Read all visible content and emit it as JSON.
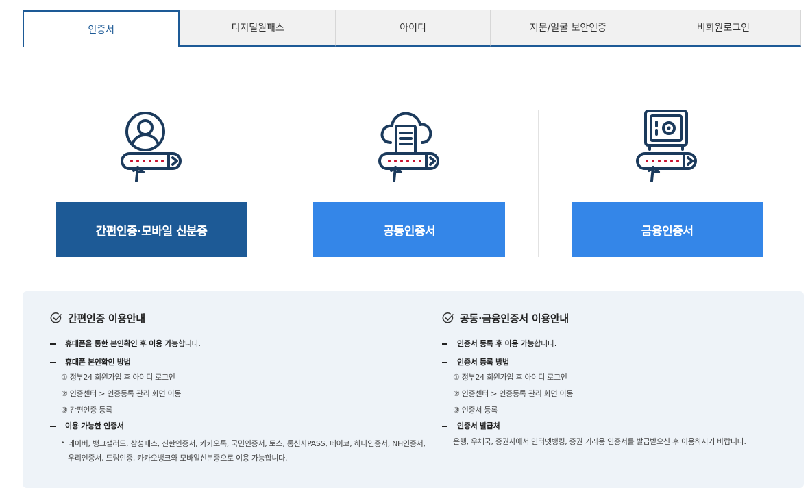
{
  "tabs": [
    {
      "label": "인증서",
      "active": true
    },
    {
      "label": "디지털원패스",
      "active": false
    },
    {
      "label": "아이디",
      "active": false
    },
    {
      "label": "지문/얼굴 보안인증",
      "active": false
    },
    {
      "label": "비회원로그인",
      "active": false
    }
  ],
  "options": [
    {
      "icon": "user-certificate-icon",
      "label": "간편인증·모바일 신분증",
      "color": "#1d5a96"
    },
    {
      "icon": "cloud-certificate-icon",
      "label": "공동인증서",
      "color": "#3486e8"
    },
    {
      "icon": "safe-certificate-icon",
      "label": "금융인증서",
      "color": "#3486e8"
    }
  ],
  "guide_left": {
    "title": "간편인증 이용안내",
    "item1_bold": "휴대폰을 통한 본인확인 후 이용 가능",
    "item1_rest": "합니다.",
    "item2": "휴대폰 본인확인 방법",
    "steps": [
      "① 정부24 회원가입 후 아이디 로그인",
      "② 인증센터 > 인증등록 관리 화면 이동",
      "③ 간편인증 등록"
    ],
    "item3": "이용 가능한 인증서",
    "bullet_mark": "•",
    "bullet": "네이버, 뱅크샐러드, 삼성패스, 신한인증서, 카카오톡, 국민인증서, 토스, 통신사PASS, 페이코, 하나인증서, NH인증서, 우리인증서, 드림인증, 카카오뱅크와 모바일신분증으로 이용 가능합니다."
  },
  "guide_right": {
    "title": "공동·금융인증서 이용안내",
    "item1_bold": "인증서 등록 후 이용 가능",
    "item1_rest": "합니다.",
    "item2": "인증서 등록 방법",
    "steps": [
      "① 정부24 회원가입 후 아이디 로그인",
      "② 인증센터 > 인증등록 관리 화면 이동",
      "③ 인증서 등록"
    ],
    "item3": "인증서 발급처",
    "text": "은행, 우체국, 증권사에서 인터넷뱅킹, 증권 거래용 인증서를 발급받으신 후 이용하시기 바랍니다."
  }
}
